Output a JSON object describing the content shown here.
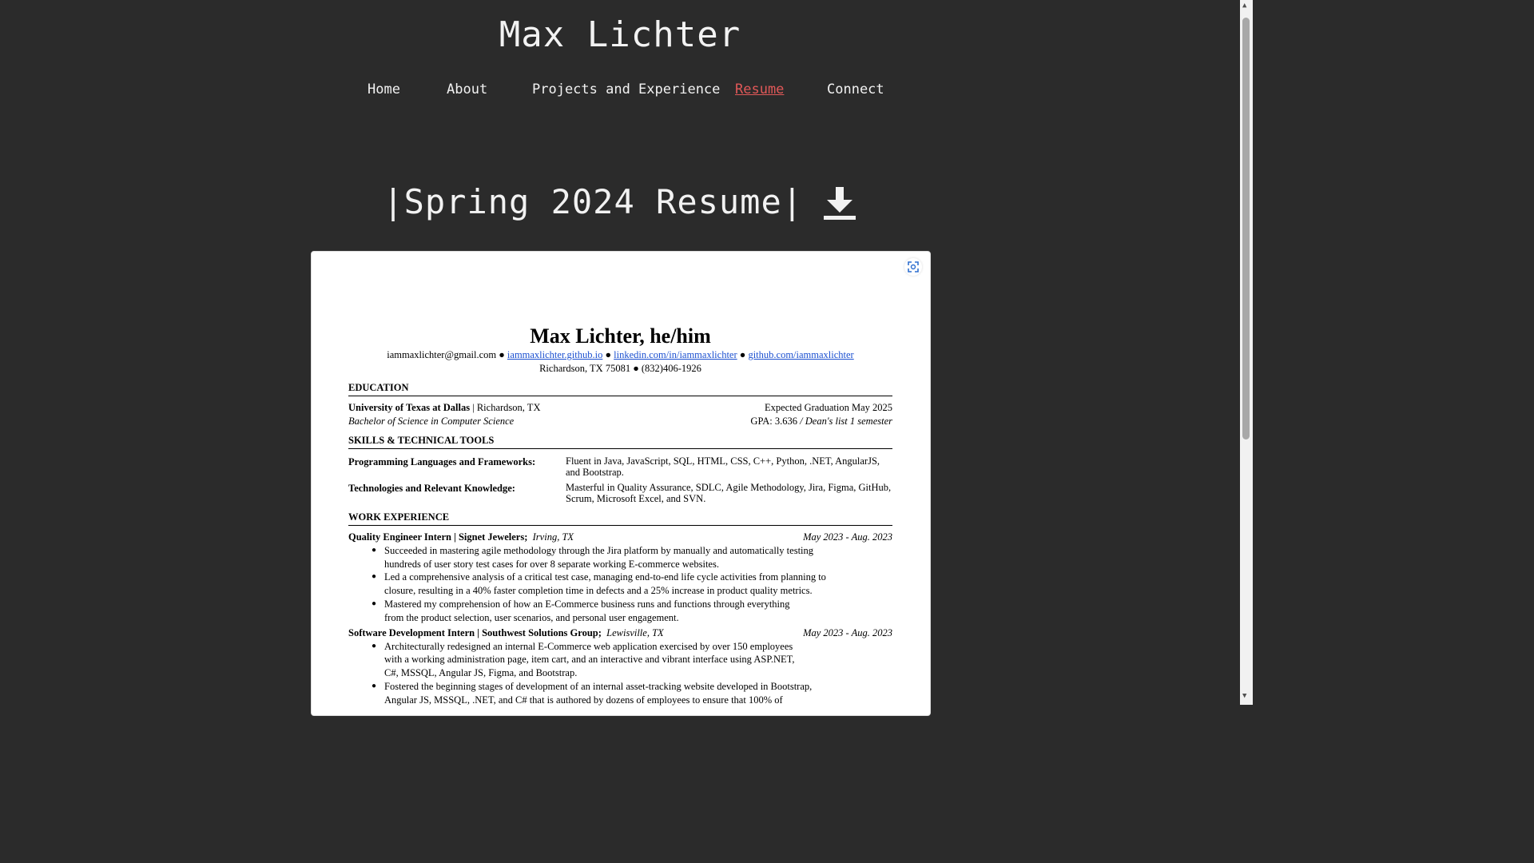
{
  "site": {
    "title": "Max Lichter"
  },
  "nav": {
    "items": [
      "Home",
      "About",
      "Projects and Experience",
      "Resume",
      "Connect"
    ],
    "active": "Resume"
  },
  "page": {
    "heading": "|Spring 2024 Resume|",
    "download_icon": "download-arrow-icon",
    "fullscreen_icon": "expand-icon"
  },
  "resume": {
    "name": "Max Lichter, he/him",
    "email": "iammaxlichter@gmail.com",
    "sep": "●",
    "site_link": "iammaxlichter.github.io",
    "linkedin": "linkedin.com/in/iammaxlichter",
    "github": "github.com/iammaxlichter",
    "address_line": "Richardson, TX 75081 ● (832)406-1926",
    "education": {
      "title": "EDUCATION",
      "school": "University of Texas at Dallas",
      "location": " | Richardson, TX",
      "grad": "Expected Graduation May 2025",
      "degree": "Bachelor of Science in Computer Science",
      "gpa": "GPA: 3.636",
      "deans": " / Dean's list 1 semester"
    },
    "skills": {
      "title": "SKILLS & TECHNICAL TOOLS",
      "rows": [
        {
          "label": "Programming Languages and Frameworks:",
          "value": "Fluent in Java, JavaScript, SQL, HTML, CSS, C++, Python, .NET, AngularJS, and Bootstrap."
        },
        {
          "label": "Technologies and Relevant Knowledge:",
          "value": "Masterful in Quality Assurance, SDLC, Agile Methodology, Jira, Figma, GitHub, Scrum, Microsoft Excel, and SVN."
        }
      ]
    },
    "work": {
      "title": "WORK EXPERIENCE",
      "jobs": [
        {
          "role": "Quality Engineer Intern | Signet Jewelers;",
          "place": "Irving, TX",
          "dates": "May 2023 - Aug. 2023",
          "bullets": [
            "Succeeded in mastering agile methodology through the Jira platform by manually and automatically testing hundreds of user story test cases for over 8 separate working E-commerce websites.",
            "Led a comprehensive analysis of a critical test case, managing end-to-end life cycle activities from planning to closure, resulting in a 40% faster completion time in defects and a 25% increase in product quality metrics.",
            "Mastered my comprehension of how an E-Commerce business runs and functions through everything from the product selection, user scenarios, and personal user engagement."
          ]
        },
        {
          "role": "Software Development Intern | Southwest Solutions Group;",
          "place": "Lewisville, TX",
          "dates": "May 2023 - Aug. 2023",
          "bullets": [
            "Architecturally redesigned an internal E-Commerce web application exercised by over 150 employees with a working administration page, item cart, and an interactive and vibrant interface using ASP.NET, C#, MSSQL, Angular JS, Figma, and Bootstrap.",
            "Fostered the beginning stages of development of an internal asset-tracking website developed in Bootstrap, Angular JS, MSSQL, .NET, and C# that is authored by dozens of employees to ensure that 100% of"
          ]
        }
      ]
    }
  }
}
